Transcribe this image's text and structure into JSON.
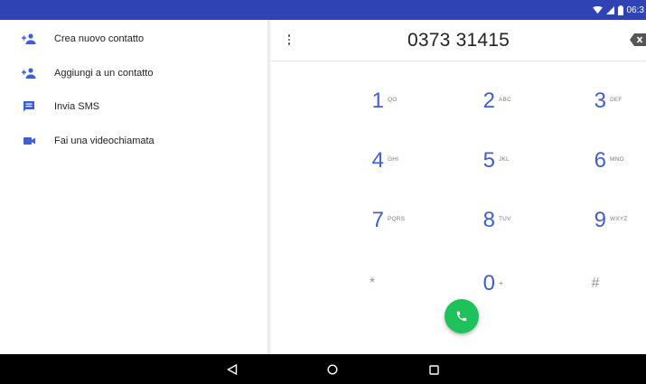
{
  "status_bar": {
    "time": "06:3",
    "icons": [
      "wifi-icon",
      "signal-icon",
      "battery-icon"
    ]
  },
  "actions": [
    {
      "label": "Crea nuovo contatto",
      "icon": "add-person-icon"
    },
    {
      "label": "Aggiungi a un contatto",
      "icon": "add-person-icon"
    },
    {
      "label": "Invia SMS",
      "icon": "message-icon"
    },
    {
      "label": "Fai una videochiamata",
      "icon": "videocam-icon"
    }
  ],
  "dialer": {
    "number": "0373 31415",
    "keys": [
      {
        "digit": "1",
        "letters": "QO"
      },
      {
        "digit": "2",
        "letters": "ABC"
      },
      {
        "digit": "3",
        "letters": "DEF"
      },
      {
        "digit": "4",
        "letters": "GHI"
      },
      {
        "digit": "5",
        "letters": "JKL"
      },
      {
        "digit": "6",
        "letters": "MNO"
      },
      {
        "digit": "7",
        "letters": "PQRS"
      },
      {
        "digit": "8",
        "letters": "TUV"
      },
      {
        "digit": "9",
        "letters": "WXYZ"
      },
      {
        "digit": "*",
        "letters": ""
      },
      {
        "digit": "0",
        "letters": "+"
      },
      {
        "digit": "#",
        "letters": ""
      }
    ]
  },
  "colors": {
    "status_bar": "#2f43b5",
    "accent": "#3f5fd0",
    "call": "#1fc25a",
    "nav_bar": "#000000"
  }
}
